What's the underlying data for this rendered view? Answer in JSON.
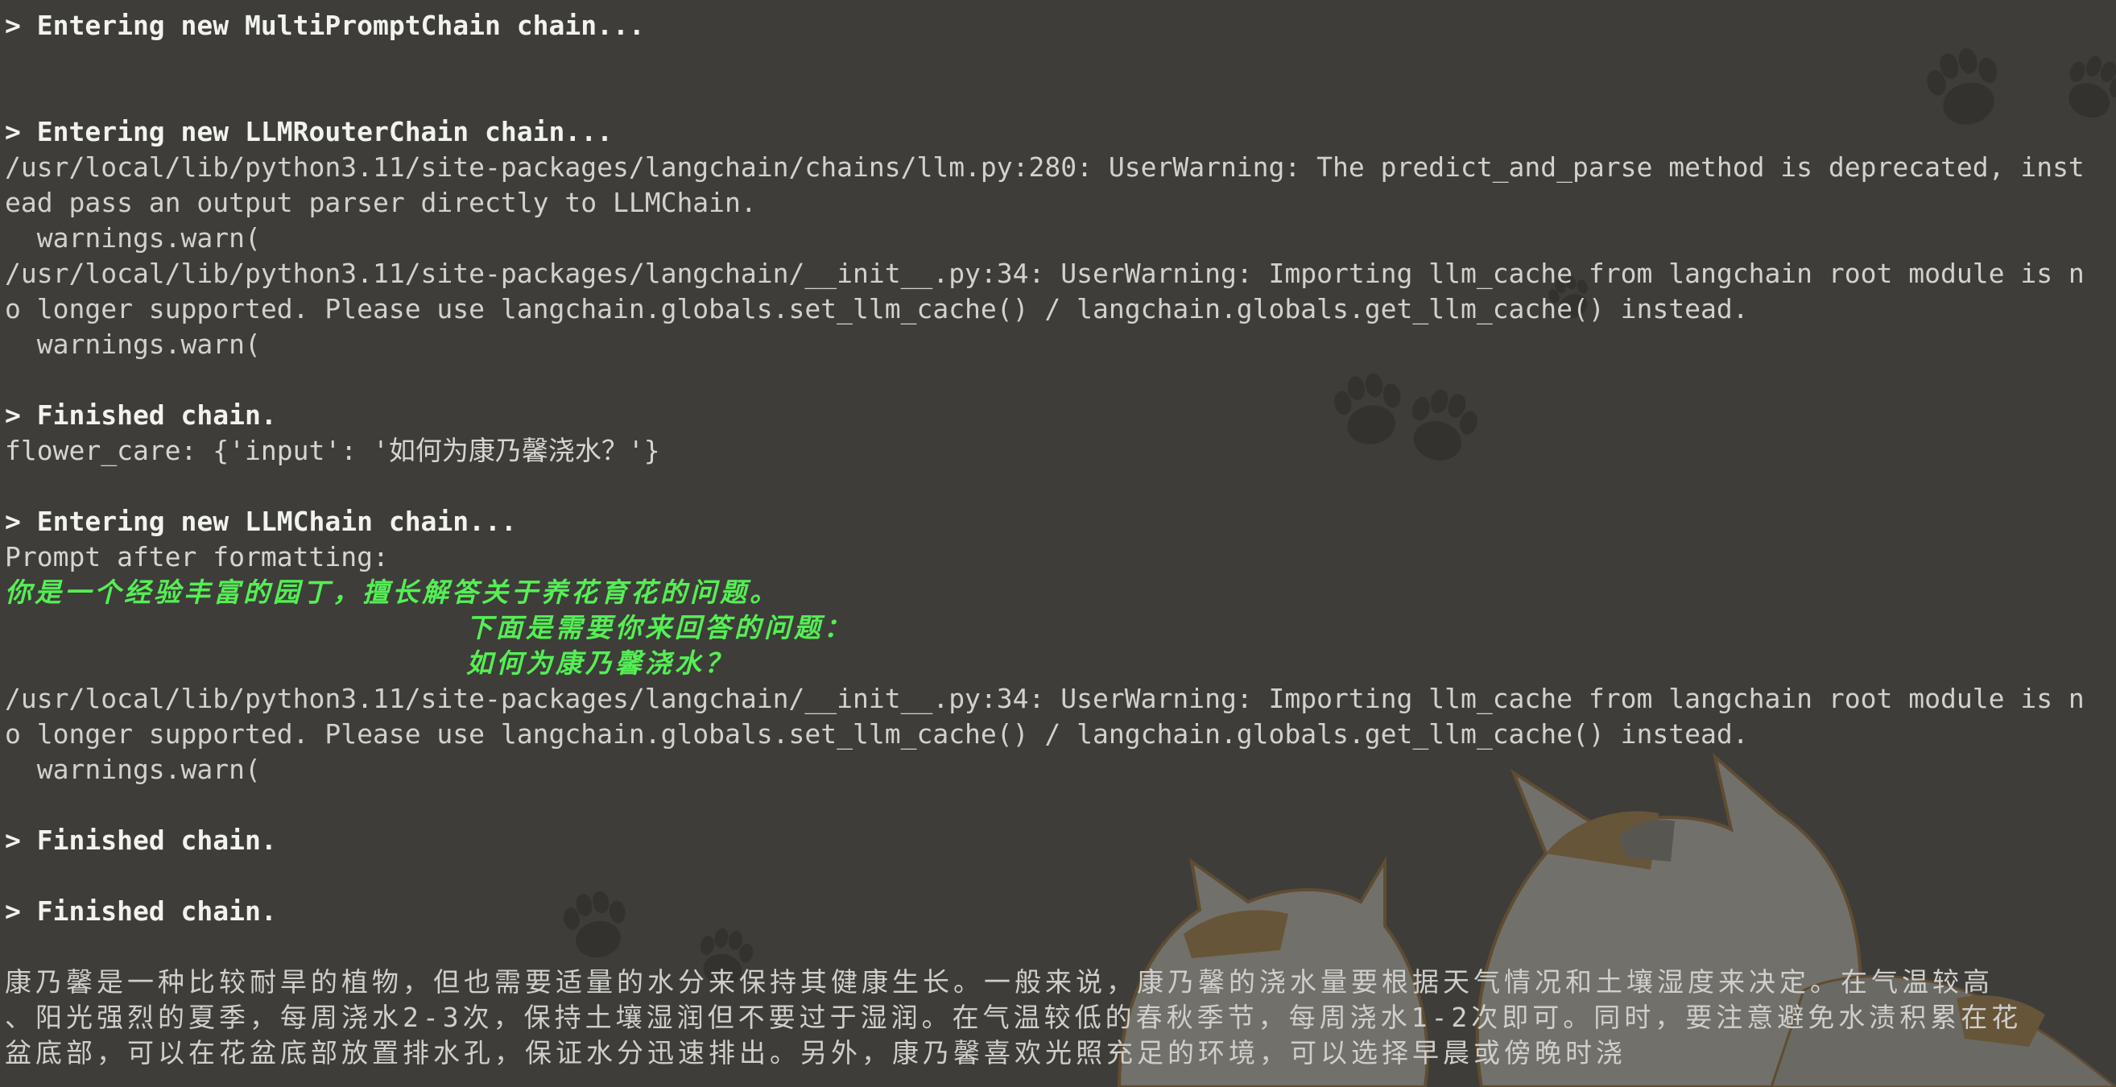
{
  "terminal": {
    "lines": {
      "l1": "> Entering new MultiPromptChain chain...",
      "l2": "> Entering new LLMRouterChain chain...",
      "l3": "/usr/local/lib/python3.11/site-packages/langchain/chains/llm.py:280: UserWarning: The predict_and_parse method is deprecated, inst",
      "l4": "ead pass an output parser directly to LLMChain.",
      "l5": "  warnings.warn(",
      "l6": "/usr/local/lib/python3.11/site-packages/langchain/__init__.py:34: UserWarning: Importing llm_cache from langchain root module is n",
      "l7": "o longer supported. Please use langchain.globals.set_llm_cache() / langchain.globals.get_llm_cache() instead.",
      "l8": "  warnings.warn(",
      "l9": "> Finished chain.",
      "l10": "flower_care: {'input': '如何为康乃馨浇水？'}",
      "l11": "> Entering new LLMChain chain...",
      "l12": "Prompt after formatting:",
      "l13": "你是一个经验丰富的园丁，擅长解答关于养花育花的问题。",
      "l14": "                        下面是需要你来回答的问题：",
      "l15": "                        如何为康乃馨浇水？",
      "l16": "/usr/local/lib/python3.11/site-packages/langchain/__init__.py:34: UserWarning: Importing llm_cache from langchain root module is n",
      "l17": "o longer supported. Please use langchain.globals.set_llm_cache() / langchain.globals.get_llm_cache() instead.",
      "l18": "  warnings.warn(",
      "l19": "> Finished chain.",
      "l20": "> Finished chain.",
      "l21": "康乃馨是一种比较耐旱的植物，但也需要适量的水分来保持其健康生长。一般来说，康乃馨的浇水量要根据天气情况和土壤湿度来决定。在气温较高",
      "l22": "、阳光强烈的夏季，每周浇水2-3次，保持土壤湿润但不要过于湿润。在气温较低的春秋季节，每周浇水1-2次即可。同时，要注意避免水渍积累在花",
      "l23": "盆底部，可以在花盆底部放置排水孔，保证水分迅速排出。另外，康乃馨喜欢光照充足的环境，可以选择早晨或傍晚时浇"
    }
  },
  "colors": {
    "background": "#3e3d39",
    "text": "#d6d5d1",
    "bold_text": "#f2f2ef",
    "prompt_green": "#55ee55",
    "paw_prints": "#34332f"
  },
  "background_art": {
    "description_icons": [
      "paw-print-icon",
      "cat-illustration"
    ]
  }
}
